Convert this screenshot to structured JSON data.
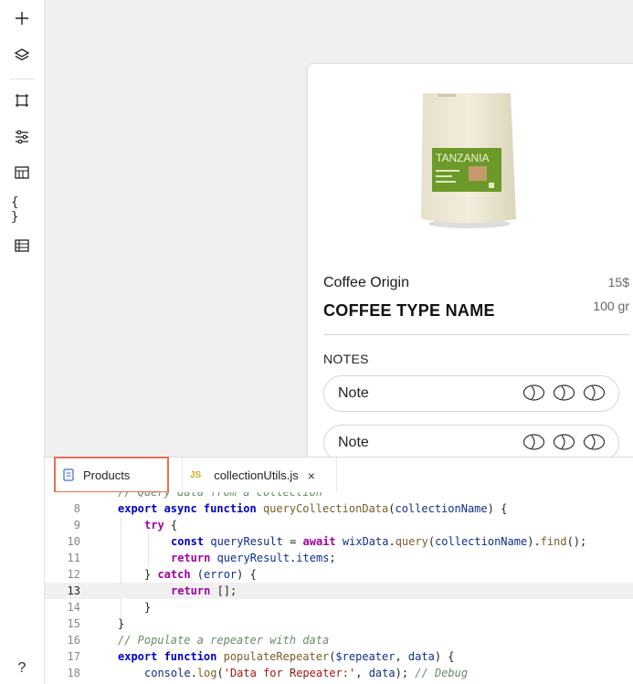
{
  "sidebar": {
    "icons": [
      "plus-icon",
      "layers-icon",
      "crop-icon",
      "sliders-icon",
      "table-icon",
      "braces-icon",
      "grid-icon",
      "help-icon"
    ],
    "help_label": "?"
  },
  "card": {
    "bag_label": "TANZANIA",
    "origin": "Coffee Origin",
    "price": "15$",
    "type_name": "COFFEE TYPE NAME",
    "weight": "100 gr",
    "notes_label": "NOTES",
    "notes": [
      {
        "label": "Note",
        "beans": 3
      },
      {
        "label": "Note",
        "beans": 3
      }
    ]
  },
  "tabs": {
    "products_label": "Products",
    "file_badge": "JS",
    "file_label": "collectionUtils.js",
    "close": "×"
  },
  "editor": {
    "current_line": 13,
    "lines": [
      {
        "n": "",
        "tokens": [
          [
            "cm",
            "// Query data from a collection"
          ]
        ]
      },
      {
        "n": "8",
        "tokens": [
          [
            "kw",
            "export async function "
          ],
          [
            "fn",
            "queryCollectionData"
          ],
          [
            "p",
            "("
          ],
          [
            "id",
            "collectionName"
          ],
          [
            "p",
            ") {"
          ]
        ]
      },
      {
        "n": "9",
        "tokens": [
          [
            "kw2",
            "try"
          ],
          [
            "p",
            " {"
          ]
        ]
      },
      {
        "n": "10",
        "tokens": [
          [
            "kw",
            "const "
          ],
          [
            "id",
            "queryResult"
          ],
          [
            "p",
            " = "
          ],
          [
            "kw2",
            "await "
          ],
          [
            "id",
            "wixData"
          ],
          [
            "p",
            "."
          ],
          [
            "fn",
            "query"
          ],
          [
            "p",
            "("
          ],
          [
            "id",
            "collectionName"
          ],
          [
            "p",
            ")."
          ],
          [
            "fn",
            "find"
          ],
          [
            "p",
            "();"
          ]
        ]
      },
      {
        "n": "11",
        "tokens": [
          [
            "kw2",
            "return "
          ],
          [
            "id",
            "queryResult"
          ],
          [
            "p",
            "."
          ],
          [
            "id",
            "items"
          ],
          [
            "p",
            ";"
          ]
        ]
      },
      {
        "n": "12",
        "tokens": [
          [
            "p",
            "} "
          ],
          [
            "kw2",
            "catch"
          ],
          [
            "p",
            " ("
          ],
          [
            "id",
            "error"
          ],
          [
            "p",
            ") {"
          ]
        ]
      },
      {
        "n": "13",
        "tokens": [
          [
            "kw2",
            "return"
          ],
          [
            "p",
            " [];"
          ]
        ]
      },
      {
        "n": "14",
        "tokens": [
          [
            "p",
            "}"
          ]
        ]
      },
      {
        "n": "15",
        "tokens": [
          [
            "p",
            "}"
          ]
        ]
      },
      {
        "n": "16",
        "tokens": [
          [
            "cm",
            "// Populate a repeater with data"
          ]
        ]
      },
      {
        "n": "17",
        "tokens": [
          [
            "kw",
            "export function "
          ],
          [
            "fn",
            "populateRepeater"
          ],
          [
            "p",
            "("
          ],
          [
            "id",
            "$repeater"
          ],
          [
            "p",
            ", "
          ],
          [
            "id",
            "data"
          ],
          [
            "p",
            ") {"
          ]
        ]
      },
      {
        "n": "18",
        "tokens": [
          [
            "id",
            "console"
          ],
          [
            "p",
            "."
          ],
          [
            "fn",
            "log"
          ],
          [
            "p",
            "("
          ],
          [
            "str",
            "'Data for Repeater:'"
          ],
          [
            "p",
            ", "
          ],
          [
            "id",
            "data"
          ],
          [
            "p",
            "); "
          ],
          [
            "cm",
            "// Debug"
          ]
        ]
      }
    ]
  }
}
